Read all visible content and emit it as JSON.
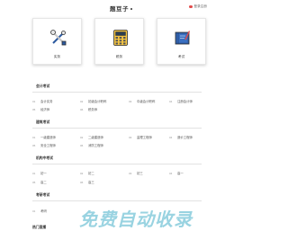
{
  "header": {
    "logo": "题豆子",
    "login": "登录注册"
  },
  "cards": [
    {
      "label": "实务",
      "icon": "tools-icon"
    },
    {
      "label": "税务",
      "icon": "calculator-icon"
    },
    {
      "label": "考试",
      "icon": "notebook-icon"
    }
  ],
  "sections": [
    {
      "title": "会计考试",
      "items": [
        {
          "num": "01",
          "label": "会计实务"
        },
        {
          "num": "02",
          "label": "初级会计职称"
        },
        {
          "num": "03",
          "label": "中级会计职称"
        },
        {
          "num": "04",
          "label": "注册会计师"
        },
        {
          "num": "05",
          "label": "经济师"
        },
        {
          "num": "06",
          "label": "税务师"
        }
      ]
    },
    {
      "title": "建筑考试",
      "items": [
        {
          "num": "01",
          "label": "一级建造师"
        },
        {
          "num": "02",
          "label": "二级建造师"
        },
        {
          "num": "03",
          "label": "监理工程师"
        },
        {
          "num": "04",
          "label": "造价工程师"
        },
        {
          "num": "05",
          "label": "安全工程师"
        },
        {
          "num": "06",
          "label": "消防工程师"
        }
      ]
    },
    {
      "title": "机构中考试",
      "items": [
        {
          "num": "01",
          "label": "初一"
        },
        {
          "num": "02",
          "label": "初二"
        },
        {
          "num": "03",
          "label": "初三"
        },
        {
          "num": "04",
          "label": "高一"
        },
        {
          "num": "05",
          "label": "高二"
        },
        {
          "num": "06",
          "label": "高三"
        }
      ]
    },
    {
      "title": "考研考试",
      "items": [
        {
          "num": "01",
          "label": "考研"
        }
      ]
    }
  ],
  "hot": {
    "title": "热门直播"
  },
  "watermark": {
    "text": "免费自动收录"
  },
  "colors": {
    "accent": "#e24b4b",
    "watermark": "#46afc8"
  }
}
